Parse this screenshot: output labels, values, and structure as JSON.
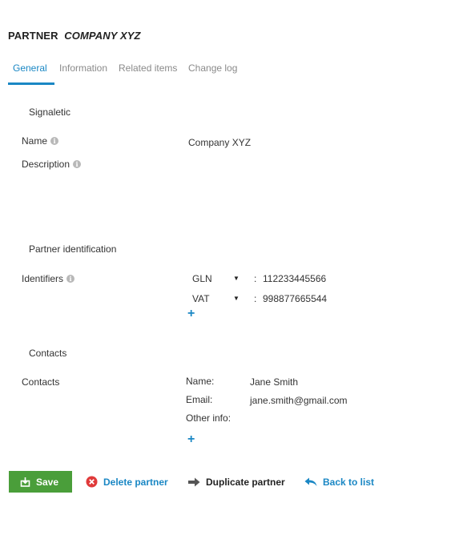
{
  "header": {
    "prefix": "PARTNER",
    "company": "COMPANY XYZ"
  },
  "tabs": [
    {
      "label": "General"
    },
    {
      "label": "Information"
    },
    {
      "label": "Related items"
    },
    {
      "label": "Change log"
    }
  ],
  "active_tab": "General",
  "signaletic": {
    "title": "Signaletic",
    "name_label": "Name",
    "name_value": "Company XYZ",
    "description_label": "Description",
    "description_value": ""
  },
  "identification": {
    "title": "Partner identification",
    "label": "Identifiers",
    "separator": ":",
    "items": [
      {
        "type": "GLN",
        "value": "112233445566"
      },
      {
        "type": "VAT",
        "value": "998877665544"
      }
    ],
    "add_symbol": "+"
  },
  "contacts": {
    "title": "Contacts",
    "label": "Contacts",
    "name_label": "Name:",
    "name_value": "Jane Smith",
    "email_label": "Email:",
    "email_value": "jane.smith@gmail.com",
    "other_label": "Other info:",
    "other_value": "",
    "add_symbol": "+"
  },
  "actions": {
    "save": "Save",
    "delete": "Delete partner",
    "duplicate": "Duplicate partner",
    "back": "Back to list"
  },
  "colors": {
    "accent": "#1a87c4",
    "save_green": "#4a9e3a",
    "delete_red": "#e03a3a"
  }
}
